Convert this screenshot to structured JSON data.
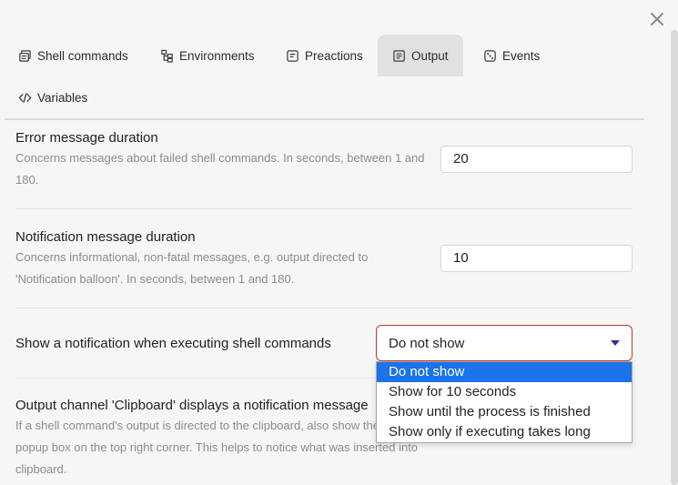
{
  "tabs": [
    {
      "label": "Shell commands",
      "icon": "shell-commands-icon",
      "active": false
    },
    {
      "label": "Environments",
      "icon": "environments-icon",
      "active": false
    },
    {
      "label": "Preactions",
      "icon": "preactions-icon",
      "active": false
    },
    {
      "label": "Output",
      "icon": "output-icon",
      "active": true
    },
    {
      "label": "Events",
      "icon": "events-icon",
      "active": false
    },
    {
      "label": "Variables",
      "icon": "variables-icon",
      "active": false
    }
  ],
  "settings": {
    "error_duration": {
      "name": "Error message duration",
      "desc": "Concerns messages about failed shell commands. In seconds, between 1 and 180.",
      "value": "20"
    },
    "notification_duration": {
      "name": "Notification message duration",
      "desc": "Concerns informational, non-fatal messages, e.g. output directed to 'Notification balloon'. In seconds, between 1 and 180.",
      "value": "10"
    },
    "show_notification": {
      "name": "Show a notification when executing shell commands",
      "selected": "Do not show",
      "options": [
        "Do not show",
        "Show for 10 seconds",
        "Show until the process is finished",
        "Show only if executing takes long"
      ]
    },
    "clipboard_notification": {
      "name": "Output channel 'Clipboard' displays a notification message",
      "desc": "If a shell command's output is directed to the clipboard, also show the output in a popup box on the top right corner. This helps to notice what was inserted into clipboard."
    }
  },
  "colors": {
    "accent_select_border": "#c0392b",
    "selected_option": "#1a73e8",
    "caret": "#3b2f8f"
  }
}
